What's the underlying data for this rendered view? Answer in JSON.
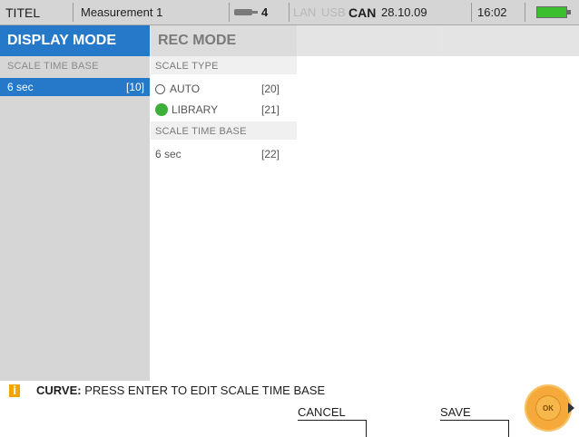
{
  "statusbar": {
    "title": "TITEL",
    "measurement": "Measurement 1",
    "battery_count": "4",
    "lan": "LAN",
    "usb": "USB",
    "can": "CAN",
    "date": "28.10.09",
    "time": "16:02",
    "colors": {
      "battery_fill": "#3bbf2e",
      "inactive": "#b9b9b9"
    }
  },
  "tabs": [
    {
      "label": "DISPLAY MODE",
      "active": true
    },
    {
      "label": "REC MODE",
      "active": false
    },
    {
      "label": "",
      "active": false
    },
    {
      "label": "",
      "active": false
    }
  ],
  "left_panel": {
    "header": "SCALE TIME BASE",
    "items": [
      {
        "label": "6 sec",
        "code": "[10]",
        "selected": true
      }
    ]
  },
  "middle_panel": {
    "scale_type_header": "SCALE TYPE",
    "options": [
      {
        "label": "AUTO",
        "code": "[20]",
        "selected": false,
        "icon": "radio-empty-icon"
      },
      {
        "label": "LIBRARY",
        "code": "[21]",
        "selected": true,
        "icon": "radio-filled-icon"
      }
    ],
    "time_base_header": "SCALE TIME BASE",
    "time_base_value": {
      "label": "6 sec",
      "code": "[22]"
    }
  },
  "info": {
    "icon": "info-icon",
    "icon_glyph": "i",
    "prefix": "CURVE:",
    "message": "PRESS ENTER TO EDIT SCALE TIME BASE"
  },
  "softkeys": {
    "cancel": "CANCEL",
    "save": "SAVE"
  },
  "ok_button": {
    "label": "OK"
  },
  "colors": {
    "accent": "#2678c8",
    "panel_gray": "#d6d6d6",
    "selected_radio": "#3db03a",
    "info_icon": "#f0a500",
    "ok_knob": "#f4a93a"
  }
}
